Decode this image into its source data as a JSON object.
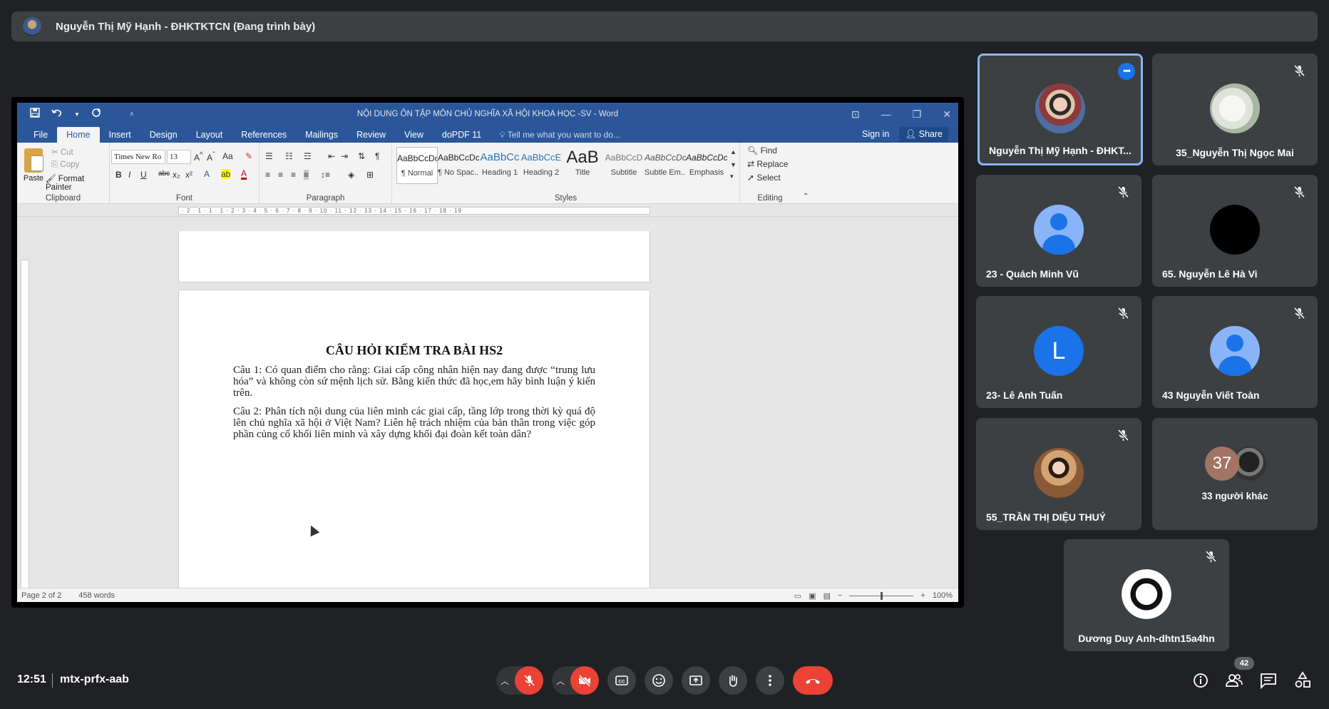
{
  "presenter": {
    "label": "Nguyễn Thị Mỹ Hạnh - ĐHKTKTCN (Đang trình bày)"
  },
  "word": {
    "title": "NỘI DUNG ÔN TẬP MÔN CHỦ NGHĨA XÃ HỘI KHOA HỌC -SV - Word",
    "tabs": [
      "File",
      "Home",
      "Insert",
      "Design",
      "Layout",
      "References",
      "Mailings",
      "Review",
      "View",
      "doPDF 11"
    ],
    "tell_me": "Tell me what you want to do...",
    "sign_in": "Sign in",
    "share": "Share",
    "clipboard": {
      "paste": "Paste",
      "cut": "Cut",
      "copy": "Copy",
      "format_painter": "Format Painter",
      "label": "Clipboard"
    },
    "font": {
      "family": "Times New Ro",
      "size": "13",
      "label": "Font"
    },
    "paragraph_label": "Paragraph",
    "styles": {
      "label": "Styles",
      "items": [
        {
          "sample": "AaBbCcDc",
          "name": "¶ Normal"
        },
        {
          "sample": "AaBbCcDc",
          "name": "¶ No Spac..."
        },
        {
          "sample": "AaBbCc",
          "name": "Heading 1"
        },
        {
          "sample": "AaBbCcE",
          "name": "Heading 2"
        },
        {
          "sample": "AaB",
          "name": "Title"
        },
        {
          "sample": "AaBbCcD",
          "name": "Subtitle"
        },
        {
          "sample": "AaBbCcDc",
          "name": "Subtle Em..."
        },
        {
          "sample": "AaBbCcDc",
          "name": "Emphasis"
        }
      ]
    },
    "editing": {
      "find": "Find",
      "replace": "Replace",
      "select": "Select",
      "label": "Editing"
    },
    "ruler_text": "· 2 · 1 · 1 · 1 · 2 · 3 · 4 · 5 · 6 · 7 · 8 · 9 · 10 · 11 · 12 · 13 · 14 · 15 · 16 · 17 · 18 · 19",
    "document": {
      "heading": "CÂU HỎI KIỂM TRA BÀI HS2",
      "q1": "Câu 1: Có quan điểm cho rằng: Giai cấp công nhân hiện nay đang được “trung lưu hóa” và không còn sứ mệnh lịch sử. Bằng kiến thức đã học,em hãy bình luận ý kiến trên.",
      "q2": "Câu 2: Phân tích nội dung của liên minh các giai cấp, tầng lớp trong thời kỳ quá độ lên chủ nghĩa xã hội ở Việt Nam? Liên hệ trách nhiệm của bản thân trong việc góp phần củng cố khối liên minh và xây dựng khối đại đoàn kết toàn dân?"
    },
    "status": {
      "page": "Page 2 of 2",
      "words": "458 words",
      "zoom": "100%"
    }
  },
  "participants": [
    {
      "name": "Nguyễn Thị Mỹ Hạnh - ĐHKT...",
      "avatar": "photo",
      "speaking": true
    },
    {
      "name": "35_Nguyễn Thị Ngọc Mai",
      "avatar": "photo",
      "muted": true
    },
    {
      "name": "23 - Quách Minh Vũ",
      "avatar": "default",
      "muted": true
    },
    {
      "name": "65. Nguyễn Lê Hà Vi",
      "avatar": "black",
      "muted": true
    },
    {
      "name": "23- Lê Anh Tuấn",
      "avatar": "letter",
      "letter": "L",
      "muted": true
    },
    {
      "name": "43 Nguyễn Viết Toàn",
      "avatar": "default",
      "muted": true
    },
    {
      "name": "55_TRẦN THỊ DIỆU THUÝ",
      "avatar": "photo",
      "muted": true
    },
    {
      "name": "33 người khác",
      "count": "37"
    },
    {
      "name": "Dương Duy Anh-dhtn15a4hn",
      "avatar": "photo",
      "muted": true
    }
  ],
  "meeting": {
    "time": "12:51",
    "code": "mtx-prfx-aab",
    "participant_count": "42"
  },
  "colors": {
    "background": "#202124",
    "tile": "#3c4043",
    "red": "#ea4335",
    "accent": "#8ab4f8",
    "word_blue": "#2b579a"
  }
}
